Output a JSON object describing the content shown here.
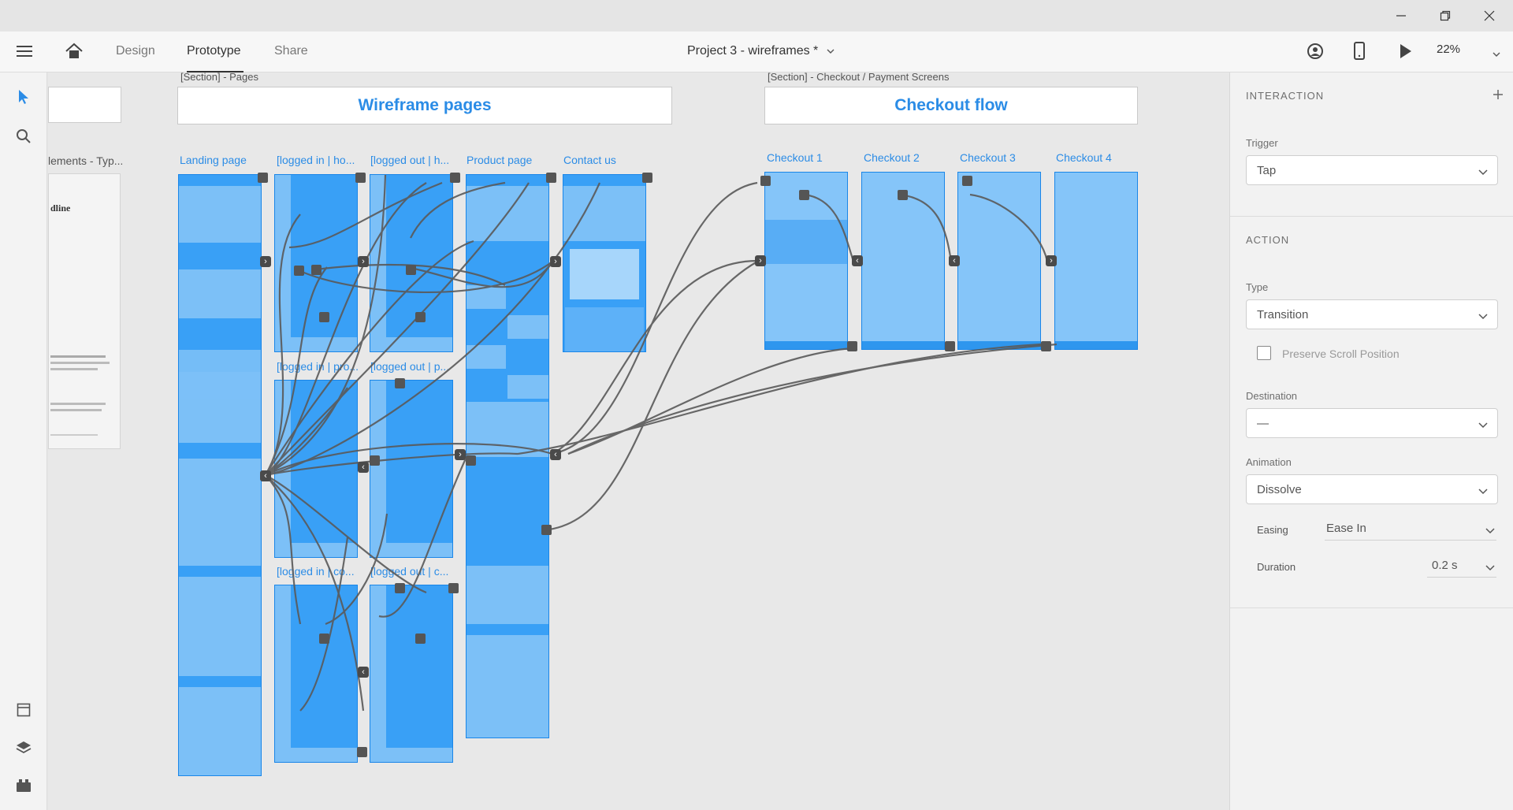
{
  "app": {
    "nav_tabs": [
      "Design",
      "Prototype",
      "Share"
    ],
    "active_tab": "Prototype",
    "document_title": "Project 3 - wireframes *",
    "zoom": "22%"
  },
  "canvas": {
    "sections": [
      {
        "title": "Wireframe pages",
        "label": "[Section] - Pages"
      },
      {
        "title": "Checkout flow",
        "label": "[Section] - Checkout / Payment Screens"
      }
    ],
    "left_partial": {
      "label": "lements - Typ...",
      "headline": "dline"
    },
    "frames": [
      "Landing page",
      "[logged in | ho...",
      "[logged out | h...",
      "Product page",
      "Contact us",
      "[logged in | pro...",
      "[logged out | p...",
      "[logged in | co...",
      "[logged out | c...",
      "Checkout 1",
      "Checkout 2",
      "Checkout 3",
      "Checkout 4"
    ]
  },
  "panel": {
    "interaction_header": "INTERACTION",
    "trigger_label": "Trigger",
    "trigger_value": "Tap",
    "action_header": "ACTION",
    "type_label": "Type",
    "type_value": "Transition",
    "preserve_scroll_label": "Preserve Scroll Position",
    "preserve_scroll_checked": false,
    "destination_label": "Destination",
    "destination_value": "—",
    "animation_label": "Animation",
    "animation_value": "Dissolve",
    "easing_label": "Easing",
    "easing_value": "Ease In",
    "duration_label": "Duration",
    "duration_value": "0.2 s"
  },
  "colors": {
    "accent": "#2b8ce6",
    "artboard": "#39a0f6",
    "wire": "#555555"
  }
}
